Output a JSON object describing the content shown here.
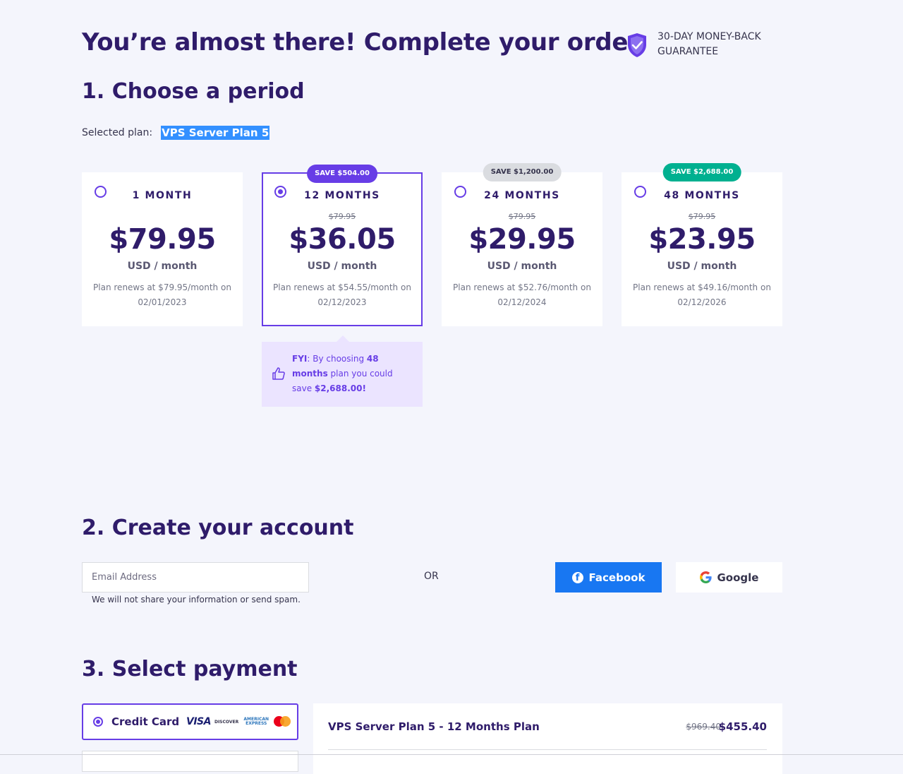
{
  "header": {
    "title": "You’re almost there! Complete your order",
    "guarantee_text": "30-DAY MONEY-BACK GUARANTEE"
  },
  "period_section": {
    "title": "1. Choose a period",
    "selected_plan_label": "Selected plan:",
    "selected_plan_name": "VPS Server Plan 5",
    "plans": [
      {
        "period": "1 MONTH",
        "old_price": "",
        "price": "$79.95",
        "unit": "USD / month",
        "renew_line1": "Plan renews at $79.95/month on",
        "renew_line2": "02/01/2023",
        "badge": "",
        "selected": false
      },
      {
        "period": "12 MONTHS",
        "old_price": "$79.95",
        "price": "$36.05",
        "unit": "USD / month",
        "renew_line1": "Plan renews at $54.55/month on",
        "renew_line2": "02/12/2023",
        "badge": "SAVE $504.00",
        "selected": true
      },
      {
        "period": "24 MONTHS",
        "old_price": "$79.95",
        "price": "$29.95",
        "unit": "USD / month",
        "renew_line1": "Plan renews at $52.76/month on",
        "renew_line2": "02/12/2024",
        "badge": "SAVE $1,200.00",
        "selected": false
      },
      {
        "period": "48 MONTHS",
        "old_price": "$79.95",
        "price": "$23.95",
        "unit": "USD / month",
        "renew_line1": "Plan renews at $49.16/month on",
        "renew_line2": "02/12/2026",
        "badge": "SAVE $2,688.00",
        "selected": false
      }
    ],
    "fyi": {
      "prefix": "FYI",
      "text1": ": By choosing ",
      "highlight_period": "48 months",
      "text2": " plan you could save ",
      "highlight_amount": "$2,688.00!"
    }
  },
  "account_section": {
    "title": "2. Create your account",
    "email_placeholder": "Email Address",
    "email_note": "We will not share your information or send spam.",
    "or_label": "OR",
    "facebook_label": "Facebook",
    "google_label": "Google"
  },
  "payment_section": {
    "title": "3. Select payment",
    "credit_card_label": "Credit Card",
    "card_logos": [
      "VISA",
      "DISCOVER",
      "AMERICAN EXPRESS",
      "mastercard"
    ],
    "summary": {
      "item_name": "VPS Server Plan 5 - 12 Months Plan",
      "old_price": "$969.40",
      "new_price": "$455.40"
    }
  },
  "colors": {
    "background": "#f4f5fc",
    "primary": "#673de6",
    "heading": "#2f1c6a",
    "facebook": "#1877f2",
    "badge_green": "#00b090",
    "badge_grey": "#dadce0",
    "fyi_bg": "#ebe4ff"
  }
}
